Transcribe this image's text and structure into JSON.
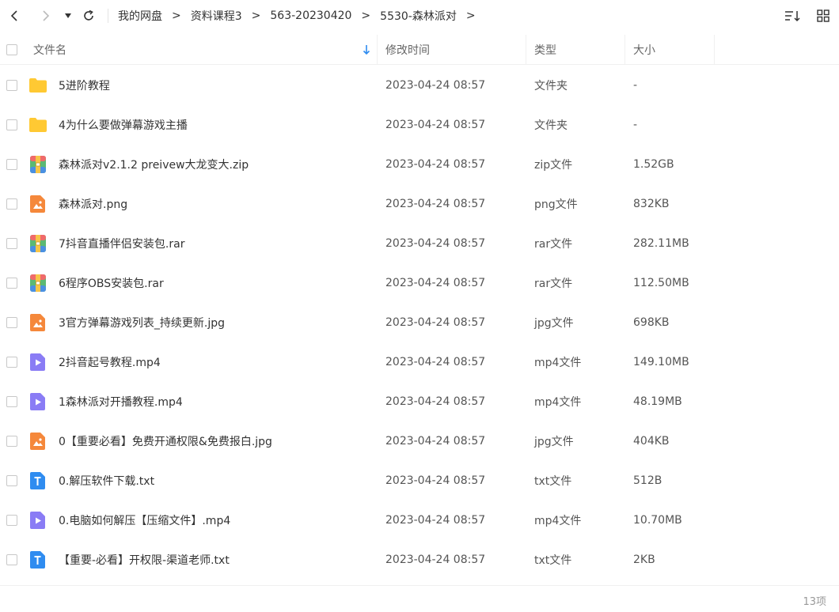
{
  "breadcrumb": [
    "我的网盘",
    "资料课程3",
    "563-20230420",
    "5530-森林派对"
  ],
  "breadcrumb_separator": ">",
  "columns": {
    "name": "文件名",
    "modified": "修改时间",
    "type": "类型",
    "size": "大小"
  },
  "colors": {
    "folder": "#FFC933",
    "image": "#F5883B",
    "video": "#8A7CF5",
    "text": "#2F8CF0",
    "sort_arrow": "#2F8CF0"
  },
  "files": [
    {
      "icon": "folder-icon",
      "name": "5进阶教程",
      "modified": "2023-04-24 08:57",
      "type": "文件夹",
      "size": "-"
    },
    {
      "icon": "folder-icon",
      "name": "4为什么要做弹幕游戏主播",
      "modified": "2023-04-24 08:57",
      "type": "文件夹",
      "size": "-"
    },
    {
      "icon": "archive-icon",
      "name": "森林派对v2.1.2 preivew大龙变大.zip",
      "modified": "2023-04-24 08:57",
      "type": "zip文件",
      "size": "1.52GB"
    },
    {
      "icon": "image-icon",
      "name": "森林派对.png",
      "modified": "2023-04-24 08:57",
      "type": "png文件",
      "size": "832KB"
    },
    {
      "icon": "archive-icon",
      "name": "7抖音直播伴侣安装包.rar",
      "modified": "2023-04-24 08:57",
      "type": "rar文件",
      "size": "282.11MB"
    },
    {
      "icon": "archive-icon",
      "name": "6程序OBS安装包.rar",
      "modified": "2023-04-24 08:57",
      "type": "rar文件",
      "size": "112.50MB"
    },
    {
      "icon": "image-icon",
      "name": "3官方弹幕游戏列表_持续更新.jpg",
      "modified": "2023-04-24 08:57",
      "type": "jpg文件",
      "size": "698KB"
    },
    {
      "icon": "video-icon",
      "name": "2抖音起号教程.mp4",
      "modified": "2023-04-24 08:57",
      "type": "mp4文件",
      "size": "149.10MB"
    },
    {
      "icon": "video-icon",
      "name": "1森林派对开播教程.mp4",
      "modified": "2023-04-24 08:57",
      "type": "mp4文件",
      "size": "48.19MB"
    },
    {
      "icon": "image-icon",
      "name": "0【重要必看】免费开通权限&免费报白.jpg",
      "modified": "2023-04-24 08:57",
      "type": "jpg文件",
      "size": "404KB"
    },
    {
      "icon": "text-icon",
      "name": "0.解压软件下载.txt",
      "modified": "2023-04-24 08:57",
      "type": "txt文件",
      "size": "512B"
    },
    {
      "icon": "video-icon",
      "name": "0.电脑如何解压【压缩文件】.mp4",
      "modified": "2023-04-24 08:57",
      "type": "mp4文件",
      "size": "10.70MB"
    },
    {
      "icon": "text-icon",
      "name": "【重要-必看】开权限-渠道老师.txt",
      "modified": "2023-04-24 08:57",
      "type": "txt文件",
      "size": "2KB"
    }
  ],
  "item_count": "13项"
}
